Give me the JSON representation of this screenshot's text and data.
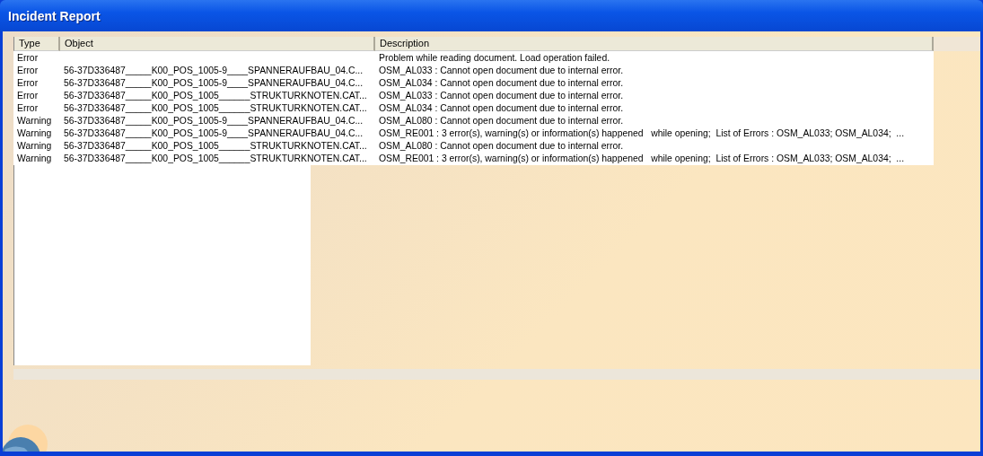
{
  "window": {
    "title": "Incident Report"
  },
  "table": {
    "columns": [
      "Type",
      "Object",
      "Description"
    ],
    "rows": [
      {
        "type": "Error",
        "object": "",
        "description": "Problem while reading document. Load operation failed."
      },
      {
        "type": "Error",
        "object": "56-37D336487_____K00_POS_1005-9____SPANNERAUFBAU_04.C...",
        "description": "OSM_AL033 : Cannot open document due to internal error."
      },
      {
        "type": "Error",
        "object": "56-37D336487_____K00_POS_1005-9____SPANNERAUFBAU_04.C...",
        "description": "OSM_AL034 : Cannot open document due to internal error."
      },
      {
        "type": "Error",
        "object": "56-37D336487_____K00_POS_1005______STRUKTURKNOTEN.CAT...",
        "description": "OSM_AL033 : Cannot open document due to internal error."
      },
      {
        "type": "Error",
        "object": "56-37D336487_____K00_POS_1005______STRUKTURKNOTEN.CAT...",
        "description": "OSM_AL034 : Cannot open document due to internal error."
      },
      {
        "type": "Warning",
        "object": "56-37D336487_____K00_POS_1005-9____SPANNERAUFBAU_04.C...",
        "description": "OSM_AL080 : Cannot open document due to internal error."
      },
      {
        "type": "Warning",
        "object": "56-37D336487_____K00_POS_1005-9____SPANNERAUFBAU_04.C...",
        "description": "OSM_RE001 : 3 error(s), warning(s) or information(s) happened   while opening;  List of Errors : OSM_AL033; OSM_AL034;  ..."
      },
      {
        "type": "Warning",
        "object": "56-37D336487_____K00_POS_1005______STRUKTURKNOTEN.CAT...",
        "description": "OSM_AL080 : Cannot open document due to internal error."
      },
      {
        "type": "Warning",
        "object": "56-37D336487_____K00_POS_1005______STRUKTURKNOTEN.CAT...",
        "description": "OSM_RE001 : 3 error(s), warning(s) or information(s) happened   while opening;  List of Errors : OSM_AL033; OSM_AL034;  ..."
      }
    ]
  }
}
